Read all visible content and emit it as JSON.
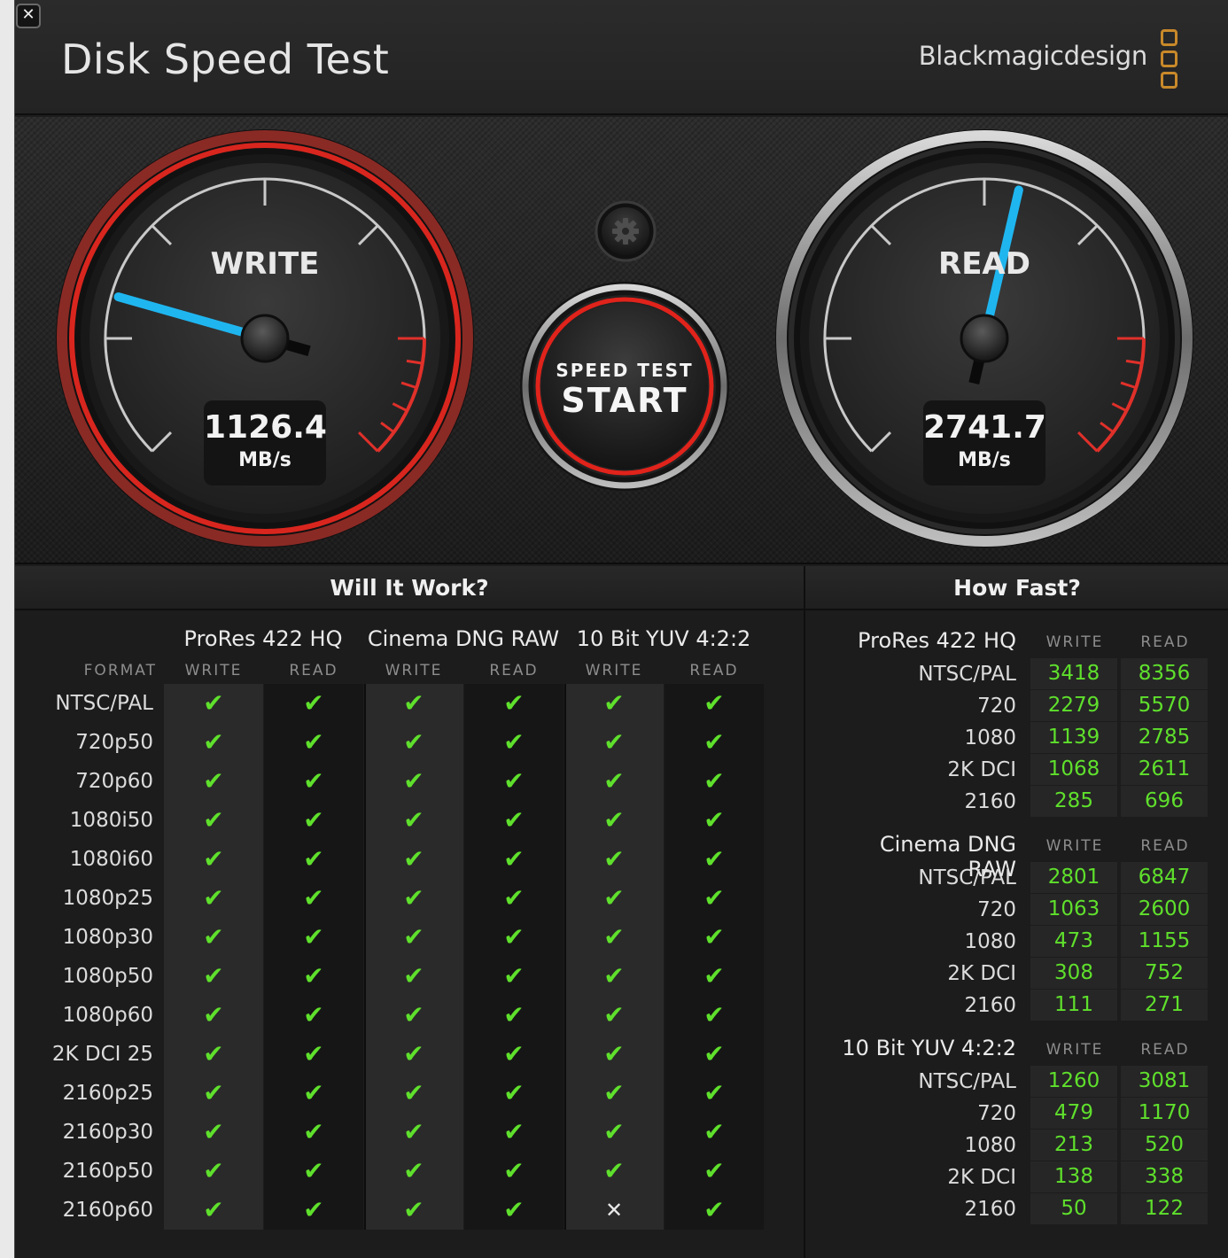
{
  "window": {
    "title": "Disk Speed Test",
    "brand": "Blackmagicdesign",
    "close_label": "✕"
  },
  "gauges": {
    "write": {
      "label": "WRITE",
      "value": "1126.4",
      "unit": "MB/s"
    },
    "read": {
      "label": "READ",
      "value": "2741.7",
      "unit": "MB/s"
    },
    "start": {
      "line1": "SPEED TEST",
      "line2": "START"
    }
  },
  "will_it_work": {
    "title": "Will It Work?",
    "format_label": "FORMAT",
    "codecs": [
      "ProRes 422 HQ",
      "Cinema DNG RAW",
      "10 Bit YUV 4:2:2"
    ],
    "sub": [
      "WRITE",
      "READ"
    ],
    "rows": [
      {
        "label": "NTSC/PAL",
        "results": [
          true,
          true,
          true,
          true,
          true,
          true
        ]
      },
      {
        "label": "720p50",
        "results": [
          true,
          true,
          true,
          true,
          true,
          true
        ]
      },
      {
        "label": "720p60",
        "results": [
          true,
          true,
          true,
          true,
          true,
          true
        ]
      },
      {
        "label": "1080i50",
        "results": [
          true,
          true,
          true,
          true,
          true,
          true
        ]
      },
      {
        "label": "1080i60",
        "results": [
          true,
          true,
          true,
          true,
          true,
          true
        ]
      },
      {
        "label": "1080p25",
        "results": [
          true,
          true,
          true,
          true,
          true,
          true
        ]
      },
      {
        "label": "1080p30",
        "results": [
          true,
          true,
          true,
          true,
          true,
          true
        ]
      },
      {
        "label": "1080p50",
        "results": [
          true,
          true,
          true,
          true,
          true,
          true
        ]
      },
      {
        "label": "1080p60",
        "results": [
          true,
          true,
          true,
          true,
          true,
          true
        ]
      },
      {
        "label": "2K DCI 25",
        "results": [
          true,
          true,
          true,
          true,
          true,
          true
        ]
      },
      {
        "label": "2160p25",
        "results": [
          true,
          true,
          true,
          true,
          true,
          true
        ]
      },
      {
        "label": "2160p30",
        "results": [
          true,
          true,
          true,
          true,
          true,
          true
        ]
      },
      {
        "label": "2160p50",
        "results": [
          true,
          true,
          true,
          true,
          true,
          true
        ]
      },
      {
        "label": "2160p60",
        "results": [
          true,
          true,
          true,
          true,
          false,
          true
        ]
      }
    ],
    "check_glyph": "✔",
    "cross_glyph": "✕"
  },
  "how_fast": {
    "title": "How Fast?",
    "sub": [
      "WRITE",
      "READ"
    ],
    "groups": [
      {
        "codec": "ProRes 422 HQ",
        "rows": [
          {
            "label": "NTSC/PAL",
            "write": "3418",
            "read": "8356"
          },
          {
            "label": "720",
            "write": "2279",
            "read": "5570"
          },
          {
            "label": "1080",
            "write": "1139",
            "read": "2785"
          },
          {
            "label": "2K DCI",
            "write": "1068",
            "read": "2611"
          },
          {
            "label": "2160",
            "write": "285",
            "read": "696"
          }
        ]
      },
      {
        "codec": "Cinema DNG RAW",
        "rows": [
          {
            "label": "NTSC/PAL",
            "write": "2801",
            "read": "6847"
          },
          {
            "label": "720",
            "write": "1063",
            "read": "2600"
          },
          {
            "label": "1080",
            "write": "473",
            "read": "1155"
          },
          {
            "label": "2K DCI",
            "write": "308",
            "read": "752"
          },
          {
            "label": "2160",
            "write": "111",
            "read": "271"
          }
        ]
      },
      {
        "codec": "10 Bit YUV 4:2:2",
        "rows": [
          {
            "label": "NTSC/PAL",
            "write": "1260",
            "read": "3081"
          },
          {
            "label": "720",
            "write": "479",
            "read": "1170"
          },
          {
            "label": "1080",
            "write": "213",
            "read": "520"
          },
          {
            "label": "2K DCI",
            "write": "138",
            "read": "338"
          },
          {
            "label": "2160",
            "write": "50",
            "read": "122"
          }
        ]
      }
    ]
  },
  "colors": {
    "accent_green": "#5fe02c",
    "needle_blue": "#1fb6f0",
    "bezel_red": "#d8261e",
    "brand_orange": "#c8892a"
  },
  "icons": {
    "close": "close-icon",
    "settings": "gear-icon",
    "brand": "blackmagic-logo-icon"
  }
}
